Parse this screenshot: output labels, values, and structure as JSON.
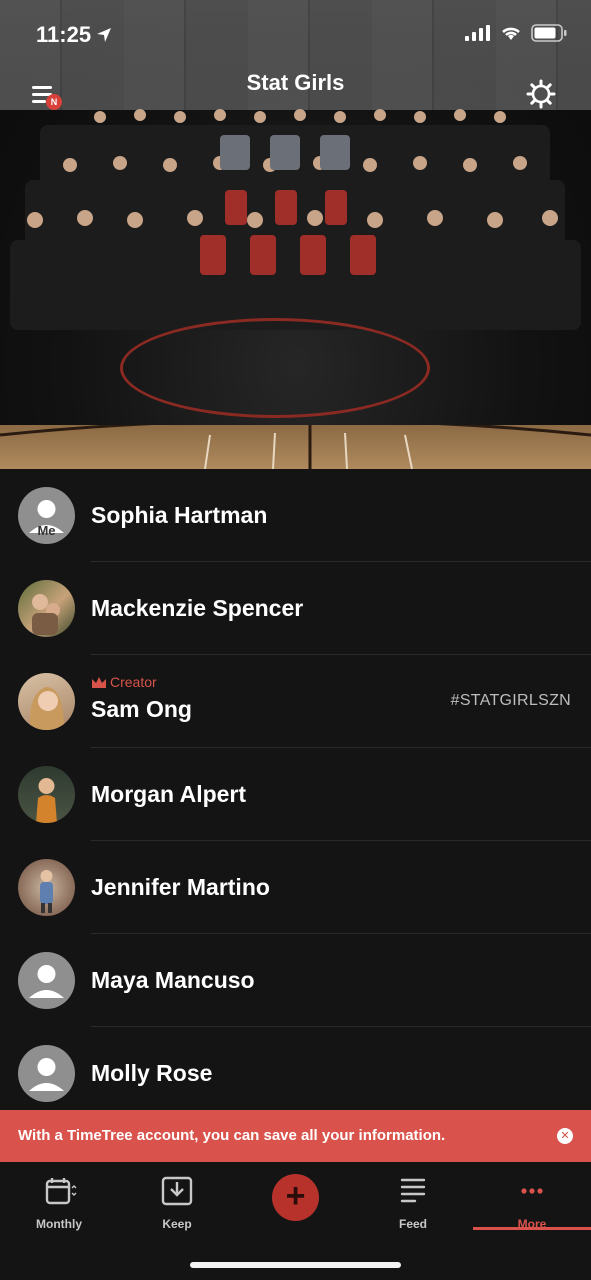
{
  "status_bar": {
    "time": "11:25"
  },
  "header": {
    "title": "Stat Girls",
    "menu_badge": "N"
  },
  "members": [
    {
      "name": "Sophia Hartman",
      "avatar_label": "Me",
      "avatar": "default-avatar-icon"
    },
    {
      "name": "Mackenzie Spencer",
      "avatar": "photo"
    },
    {
      "name": "Sam Ong",
      "role": "Creator",
      "hashtag": "#STATGIRLSZN",
      "avatar": "photo"
    },
    {
      "name": "Morgan Alpert",
      "avatar": "photo"
    },
    {
      "name": "Jennifer Martino",
      "avatar": "photo"
    },
    {
      "name": "Maya Mancuso",
      "avatar": "default-avatar-icon"
    },
    {
      "name": "Molly Rose",
      "avatar": "default-avatar-icon"
    }
  ],
  "banner": {
    "text": "With a TimeTree account, you can save all your information."
  },
  "tabs": [
    {
      "label": "Monthly",
      "icon": "calendar-icon"
    },
    {
      "label": "Keep",
      "icon": "download-tray-icon"
    },
    {
      "label": "",
      "icon": "plus-icon"
    },
    {
      "label": "Feed",
      "icon": "lines-icon"
    },
    {
      "label": "More",
      "icon": "dots-icon",
      "active": true
    }
  ],
  "colors": {
    "accent": "#d9534c",
    "background": "#141414",
    "add_button": "#b8322c"
  }
}
